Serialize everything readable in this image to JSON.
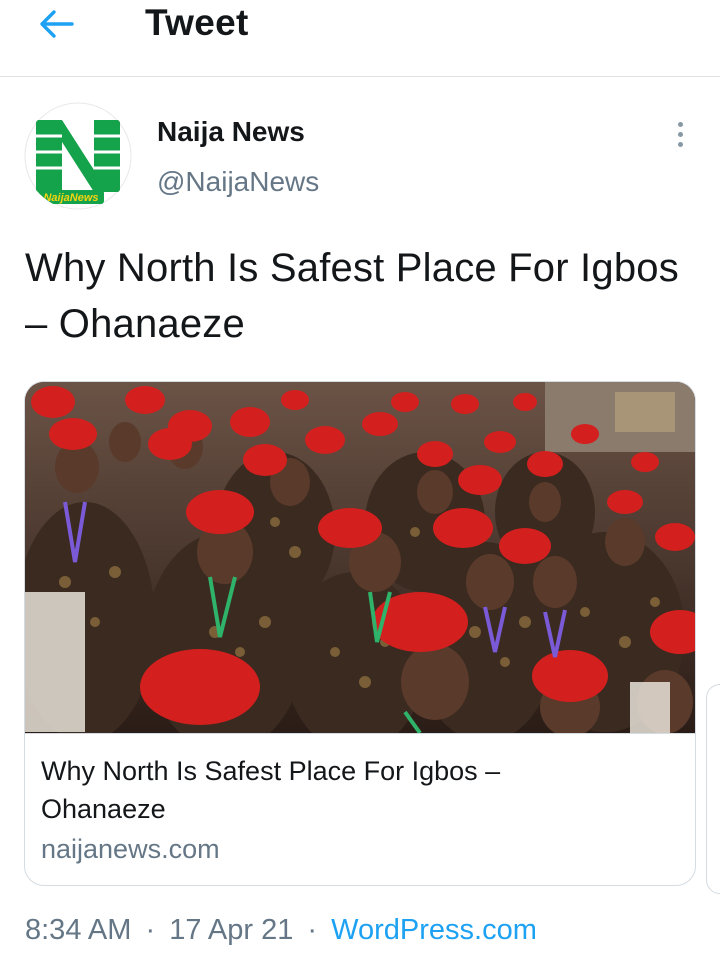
{
  "header": {
    "title": "Tweet",
    "back_icon": "arrow-left-icon",
    "accent": "#1da1f2"
  },
  "author": {
    "name": "Naija News",
    "handle": "@NaijaNews",
    "avatar_logo_text": "NaijaNews",
    "brand_color": "#14a24a"
  },
  "tweet": {
    "text": "Why North Is Safest Place For Igbos – Ohanaeze",
    "time": "8:34 AM",
    "separator": "·",
    "date": "17 Apr 21",
    "source": "WordPress.com"
  },
  "card": {
    "title": "Why North Is Safest Place For Igbos – Ohanaeze",
    "domain": "naijanews.com",
    "image_description_icon": "photo-crowd-red-caps"
  },
  "more_icon": "more-vertical-icon"
}
